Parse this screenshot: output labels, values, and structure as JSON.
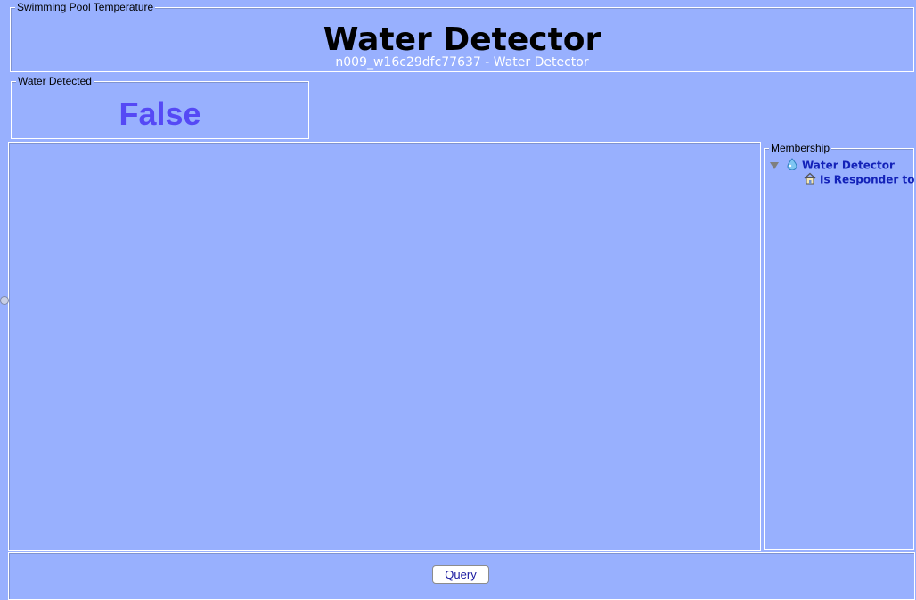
{
  "header": {
    "legend": "Swimming Pool Temperature",
    "title": "Water Detector",
    "subtitle": "n009_w16c29dfc77637 - Water Detector"
  },
  "water_detected": {
    "legend": "Water Detected",
    "value": "False"
  },
  "membership": {
    "legend": "Membership",
    "tree": {
      "root_label": "Water Detector",
      "root_icon": "water-drop-icon",
      "expanded": true,
      "children": [
        {
          "label": "Is Responder to",
          "icon": "house-icon"
        }
      ]
    }
  },
  "bottom": {
    "query_label": "Query"
  },
  "colors": {
    "background": "#98b0fe",
    "value_text": "#5549f5",
    "tree_text": "#1322b8"
  }
}
